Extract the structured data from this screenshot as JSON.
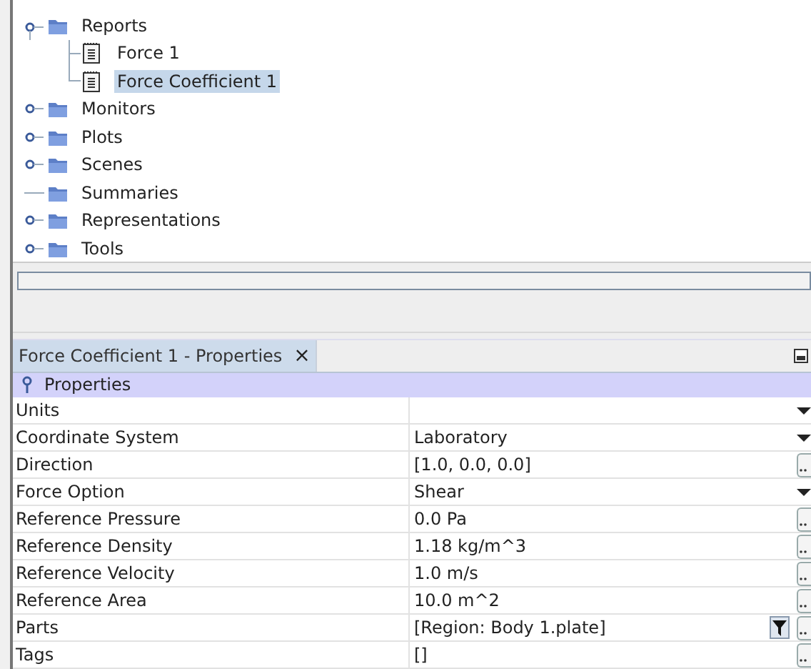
{
  "tree": [
    {
      "label": "Reports",
      "kind": "folder",
      "expanded": true,
      "has_children": true,
      "children": [
        {
          "label": "Force 1",
          "kind": "report",
          "selected": false
        },
        {
          "label": "Force Coefficient 1",
          "kind": "report",
          "selected": true
        }
      ]
    },
    {
      "label": "Monitors",
      "kind": "folder",
      "expanded": false,
      "has_children": true
    },
    {
      "label": "Plots",
      "kind": "folder",
      "expanded": false,
      "has_children": true
    },
    {
      "label": "Scenes",
      "kind": "folder",
      "expanded": false,
      "has_children": true
    },
    {
      "label": "Summaries",
      "kind": "folder",
      "has_children": false
    },
    {
      "label": "Representations",
      "kind": "folder",
      "expanded": false,
      "has_children": true
    },
    {
      "label": "Tools",
      "kind": "folder",
      "expanded": false,
      "has_children": true
    }
  ],
  "properties_panel": {
    "tab": {
      "label": "Force Coefficient 1 - Properties",
      "close": "×",
      "selected": true
    },
    "header": "Properties",
    "rows": [
      {
        "name": "Units",
        "value": "",
        "kind": "dropdown"
      },
      {
        "name": "Coordinate System",
        "value": "Laboratory",
        "kind": "dropdown"
      },
      {
        "name": "Direction",
        "value": "[1.0, 0.0, 0.0]",
        "kind": "ellipsis"
      },
      {
        "name": "Force Option",
        "value": "Shear",
        "kind": "dropdown"
      },
      {
        "name": "Reference Pressure",
        "value": "0.0 Pa",
        "kind": "ellipsis"
      },
      {
        "name": "Reference Density",
        "value": "1.18 kg/m^3",
        "kind": "ellipsis"
      },
      {
        "name": "Reference Velocity",
        "value": "1.0 m/s",
        "kind": "ellipsis"
      },
      {
        "name": "Reference Area",
        "value": "10.0 m^2",
        "kind": "ellipsis"
      },
      {
        "name": "Parts",
        "value": "[Region: Body 1.plate]",
        "kind": "filter"
      },
      {
        "name": "Tags",
        "value": "[]",
        "kind": "ellipsis"
      }
    ]
  }
}
